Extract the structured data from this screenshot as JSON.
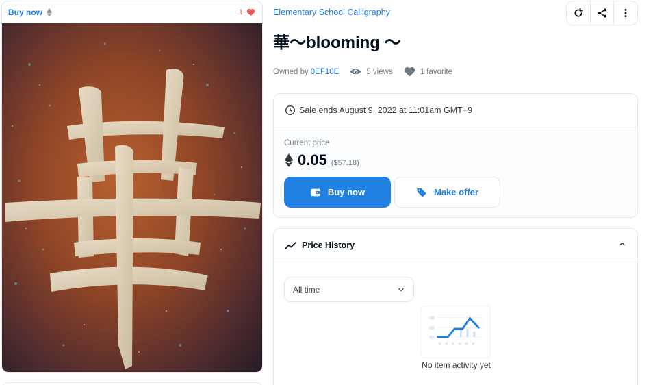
{
  "card": {
    "buy_now_label": "Buy now",
    "favorite_count": "1",
    "artwork_icon": "calligraphy-artwork-image"
  },
  "collection": {
    "name": "Elementary School Calligraphy"
  },
  "item": {
    "title": "華〜blooming 〜",
    "owned_by_label": "Owned by",
    "owner": "0EF10E",
    "views": "5 views",
    "favorites": "1 favorite"
  },
  "actions": {
    "icons": [
      "refresh-icon",
      "share-icon",
      "more-options-icon"
    ]
  },
  "sale": {
    "ends_text": "Sale ends August 9, 2022 at 11:01am GMT+9",
    "current_price_label": "Current price",
    "price": "0.05",
    "price_usd": "($57.18)",
    "buy_now_label": "Buy now",
    "make_offer_label": "Make offer"
  },
  "price_history": {
    "title": "Price History",
    "selected_range": "All time",
    "empty_text": "No item activity yet"
  },
  "colors": {
    "accent": "#2081e2",
    "heart": "#eb5757",
    "text_primary": "#04111d",
    "text_secondary": "#707a83"
  }
}
